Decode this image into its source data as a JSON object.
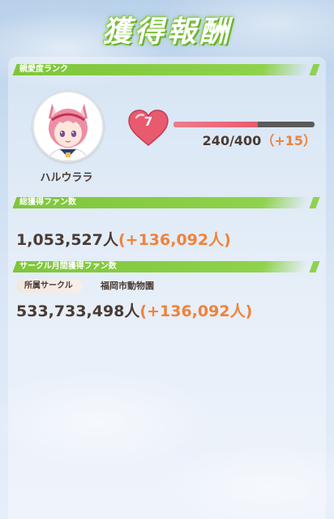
{
  "screen": {
    "title": "獲得報酬"
  },
  "sections": {
    "affinity_label": "親愛度ランク",
    "fans_label": "総獲得ファン数",
    "circle_label": "サークル月間獲得ファン数"
  },
  "character": {
    "name": "ハルウララ"
  },
  "affinity": {
    "level": "7",
    "current": 240,
    "max": 400,
    "progress_text": "240/400",
    "gain_text": "（+15）"
  },
  "fans": {
    "total": "1,053,527人",
    "gain": "(+136,092人)"
  },
  "circle": {
    "tag": "所属サークル",
    "name": "福岡市動物園",
    "total": "533,733,498人",
    "gain": "(+136,092人)"
  },
  "colors": {
    "accent_green": "#7ec63a",
    "text_brown": "#4a3b34",
    "gain_orange": "#f0823a",
    "heart_red": "#e85a6e"
  },
  "icons": {
    "heart": "heart-icon",
    "avatar": "character-portrait"
  }
}
